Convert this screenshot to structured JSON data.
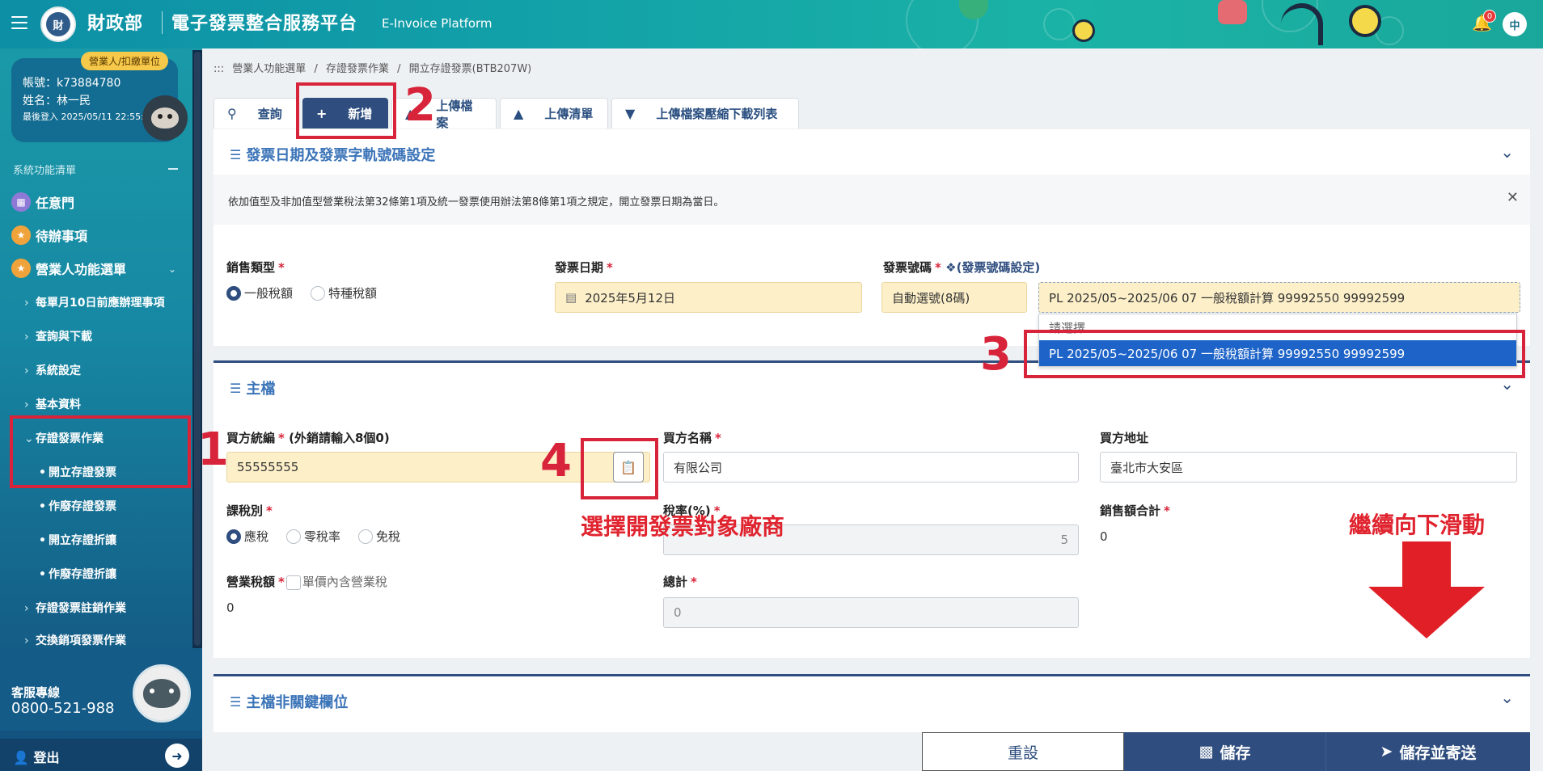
{
  "header": {
    "ministry": "財政部",
    "platform": "電子發票整合服務平台",
    "platform_en": "E-Invoice Platform",
    "logo_text": "財",
    "notification_count": "0",
    "lang": "中"
  },
  "user": {
    "role": "營業人/扣繳單位",
    "account": "帳號：k73884780",
    "name": "姓名：林一民",
    "last_login": "最後登入 2025/05/11 22:55:17"
  },
  "sidebar": {
    "menu_title": "系統功能清單",
    "top_items": [
      {
        "label": "任意門",
        "icon": "map-icon",
        "color": "#8e7ad6"
      },
      {
        "label": "待辦事項",
        "icon": "star-icon",
        "color": "#f0a33a"
      },
      {
        "label": "營業人功能選單",
        "icon": "star-icon",
        "color": "#f0a33a"
      }
    ],
    "sub_items": [
      "每單月10日前應辦理事項",
      "查詢與下載",
      "系統設定",
      "基本資料",
      "存證發票作業"
    ],
    "subsub_items": [
      "開立存證發票",
      "作廢存證發票",
      "開立存證折讓",
      "作廢存證折讓"
    ],
    "more_items": [
      "存證發票註銷作業",
      "交換銷項發票作業"
    ],
    "support_label": "客服專線",
    "support_phone": "0800-521-988",
    "logout": "登出"
  },
  "breadcrumb": [
    ":::",
    "營業人功能選單",
    "/",
    "存證發票作業",
    "/",
    "開立存證發票(BTB207W)"
  ],
  "tabs": [
    {
      "label": "查詢",
      "icon": "search-icon"
    },
    {
      "label": "新增",
      "icon": "plus-icon"
    },
    {
      "label": "上傳檔案",
      "icon": "upload-file-icon"
    },
    {
      "label": "上傳清單",
      "icon": "upload-list-icon"
    },
    {
      "label": "上傳檔案壓縮下載列表",
      "icon": "download-list-icon"
    }
  ],
  "section1": {
    "title": "發票日期及發票字軌號碼設定",
    "notice": "依加值型及非加值型營業稅法第32條第1項及統一發票使用辦法第8條第1項之規定，開立發票日期為當日。",
    "sale_type_label": "銷售類型",
    "sale_type_options": [
      "一般稅額",
      "特種稅額"
    ],
    "date_label": "發票日期",
    "date_value": "2025年5月12日",
    "number_label": "發票號碼",
    "number_link": "(發票號碼設定)",
    "auto_number": "自動選號(8碼)",
    "track_value": "PL 2025/05~2025/06  07 一般稅額計算  99992550 99992599",
    "dropdown_placeholder": "請選擇",
    "dropdown_option": "PL 2025/05~2025/06  07 一般稅額計算  99992550 99992599"
  },
  "section2": {
    "title": "主檔",
    "buyer_id_label": "買方統編",
    "buyer_id_hint": "(外銷請輸入8個0)",
    "buyer_id_value": "55555555",
    "buyer_name_label": "買方名稱",
    "buyer_name_value": "有限公司",
    "buyer_addr_label": "買方地址",
    "buyer_addr_value": "臺北市大安區",
    "tax_type_label": "課稅別",
    "tax_type_options": [
      "應稅",
      "零稅率",
      "免稅"
    ],
    "tax_rate_label": "稅率(%)",
    "tax_rate_value": "5",
    "sales_total_label": "銷售額合計",
    "sales_total_value": "0",
    "business_tax_label": "營業稅額",
    "unit_price_incl_label": "單價內含營業稅",
    "business_tax_value": "0",
    "grand_total_label": "總計",
    "grand_total_value": "0"
  },
  "section3": {
    "title": "主檔非關鍵欄位"
  },
  "annotations": {
    "n1": "1",
    "n2": "2",
    "n3": "3",
    "n4": "4",
    "select_vendor": "選擇開發票對象廠商",
    "scroll_down": "繼續向下滑動",
    "color": "#d8243a"
  },
  "actions": {
    "reset": "重設",
    "save": "儲存",
    "save_send": "儲存並寄送"
  }
}
